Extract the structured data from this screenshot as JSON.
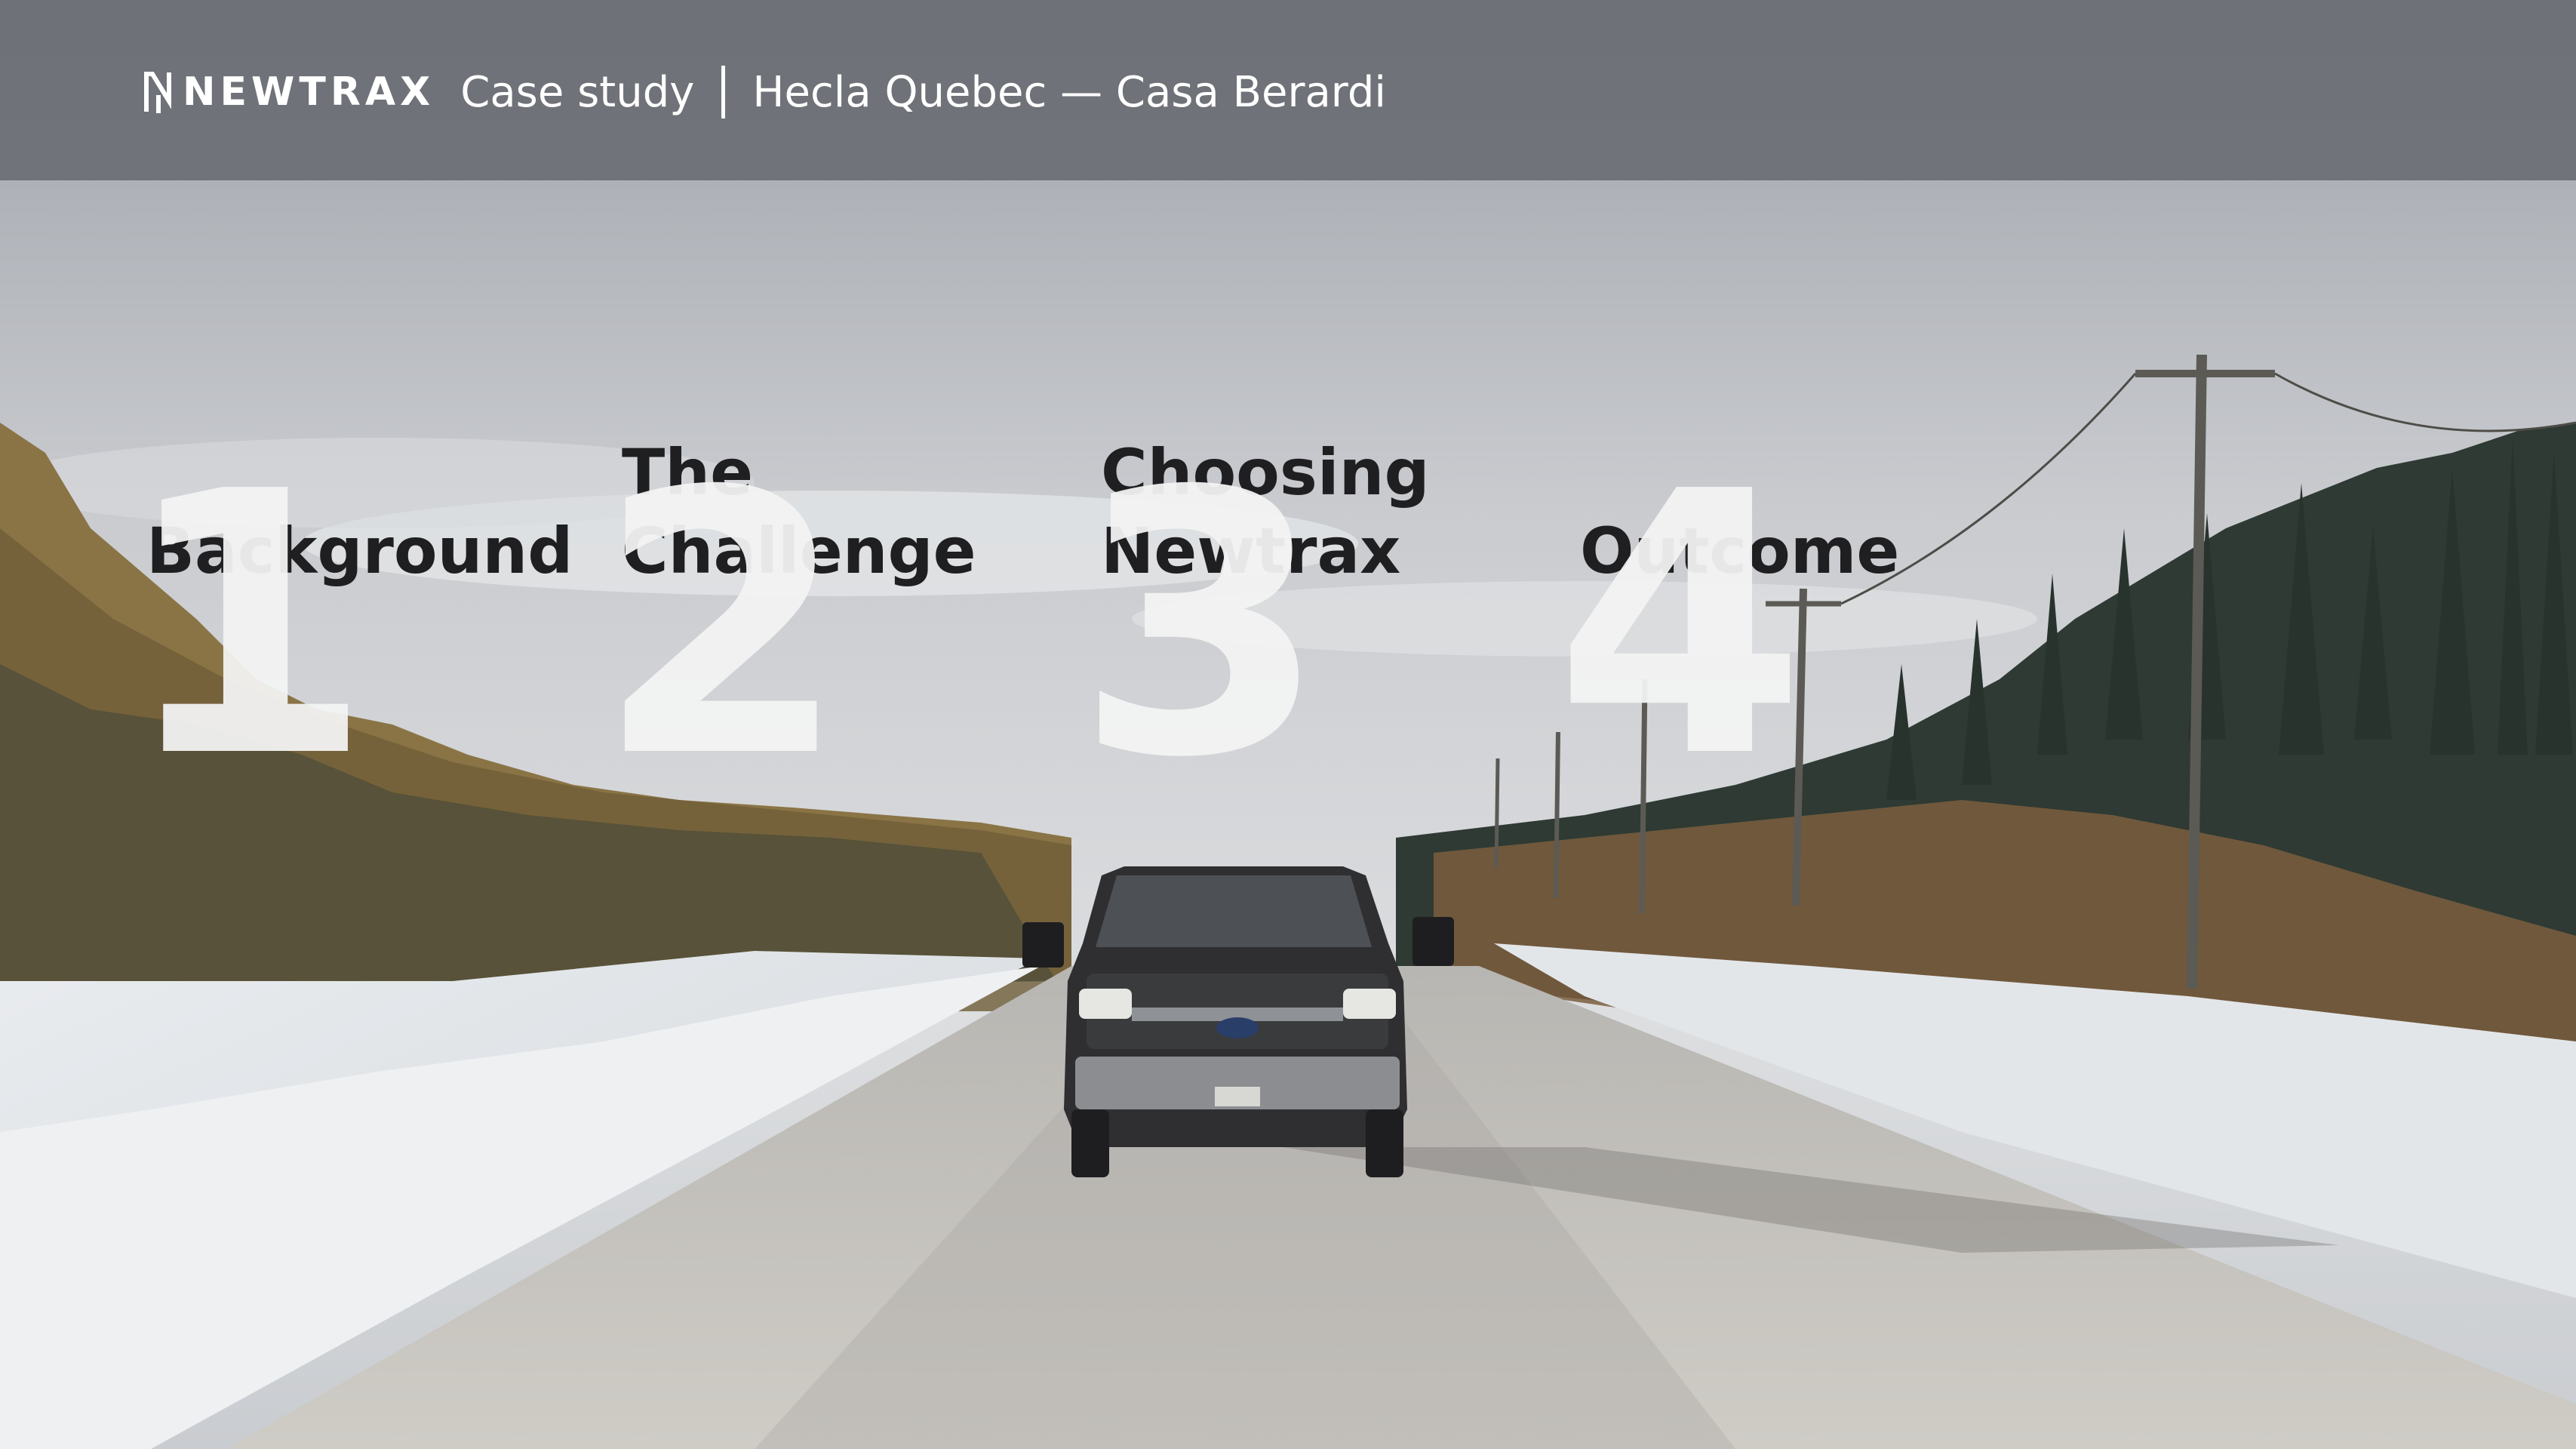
{
  "header": {
    "logo_text": "NEWTRAX",
    "label": "Case study",
    "title": "Hecla Quebec — Casa Berardi"
  },
  "sections": [
    {
      "number": "1",
      "title": "Background"
    },
    {
      "number": "2",
      "title": "The\nChallenge"
    },
    {
      "number": "3",
      "title": "Choosing\nNewtrax"
    },
    {
      "number": "4",
      "title": "Outcome"
    }
  ],
  "colors": {
    "header_background": "#62646a",
    "title_text": "#1f1f21",
    "number_text": "#f4f4f4",
    "header_text": "#ffffff"
  }
}
